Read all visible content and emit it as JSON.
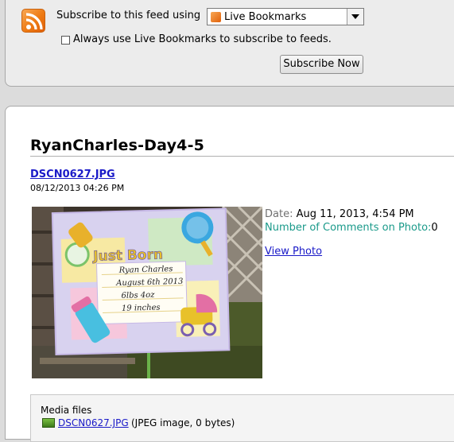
{
  "subscribe": {
    "label": "Subscribe to this feed using",
    "selected_reader": "Live Bookmarks",
    "always_use_label": "Always use Live Bookmarks to subscribe to feeds.",
    "button_label": "Subscribe Now"
  },
  "entry": {
    "title": "RyanCharles-Day4-5",
    "file_name": "DSCN0627.JPG",
    "file_datetime": "08/12/2013 04:26 PM",
    "date_label": "Date:",
    "date_value": "Aug 11, 2013, 4:54 PM",
    "comments_label": "Number of Comments on Photo:",
    "comments_value": "0",
    "view_photo_label": "View Photo"
  },
  "photo_card": {
    "heading": "Just Born",
    "name": "Ryan Charles",
    "born": "August 6th 2013",
    "weight": "6lbs 4oz",
    "length": "19 inches"
  },
  "media": {
    "title": "Media files",
    "file_link": "DSCN0627.JPG",
    "file_desc": "(JPEG image, 0 bytes)"
  },
  "colors": {
    "link": "#1a1ac8",
    "rss_orange": "#ee7a13",
    "comments_label": "#1a9a8a"
  }
}
